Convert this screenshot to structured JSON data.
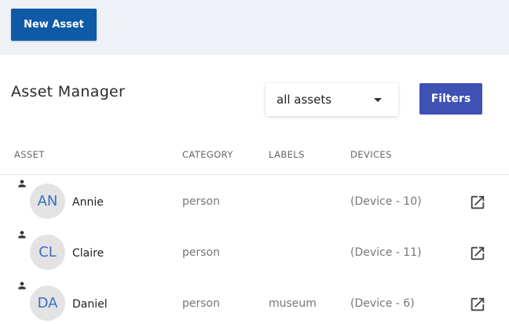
{
  "toolbar": {
    "new_asset_label": "New Asset"
  },
  "header": {
    "title": "Asset Manager"
  },
  "filter": {
    "selected": "all assets",
    "filters_label": "Filters"
  },
  "table": {
    "columns": [
      "ASSET",
      "CATEGORY",
      "LABELS",
      "DEVICES"
    ],
    "rows": [
      {
        "initials": "AN",
        "name": "Annie",
        "category": "person",
        "labels": "",
        "devices": "(Device - 10)"
      },
      {
        "initials": "CL",
        "name": "Claire",
        "category": "person",
        "labels": "",
        "devices": "(Device - 11)"
      },
      {
        "initials": "DA",
        "name": "Daniel",
        "category": "person",
        "labels": "museum",
        "devices": "(Device - 6)"
      }
    ]
  },
  "colors": {
    "primary": "#0e5aa7",
    "filters": "#3f51b5",
    "avatar_text": "#3b6fbf"
  },
  "icons": {
    "row_type": "person-icon",
    "row_action": "open-in-new-icon",
    "select": "chevron-down-icon"
  }
}
